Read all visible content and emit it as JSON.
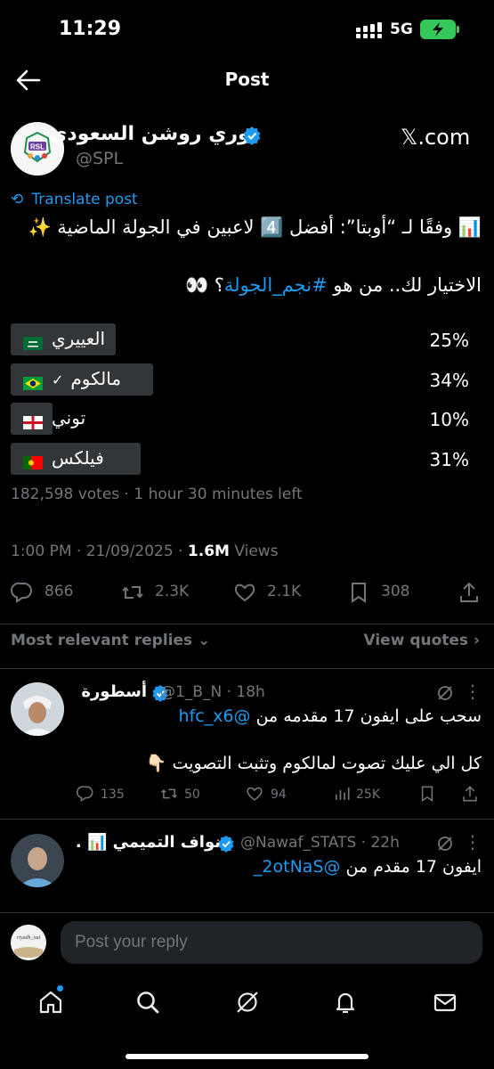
{
  "status_bar": {
    "time": "11:29",
    "network": "5G"
  },
  "header": {
    "title": "Post"
  },
  "post": {
    "author_name": "دوري روشن السعودي",
    "handle": "@SPL",
    "avatar_text": "RSL",
    "source_badge": "𝕏.com",
    "translate_label": "Translate post",
    "line1": "📊 وفقًا لـ “أوبتا”: أفضل 4️⃣ لاعبين في الجولة الماضية ✨",
    "line2_prefix": "الاختيار لك.. من هو ",
    "hashtag": "#نجم_الجولة",
    "line2_suffix": "؟ 👀",
    "poll": [
      {
        "label": "العييري",
        "percent": "25%",
        "value": 25,
        "flag": "saudi-flag"
      },
      {
        "label": "مالكوم",
        "percent": "34%",
        "value": 34,
        "flag": "brazil-flag",
        "chosen": true
      },
      {
        "label": "توني",
        "percent": "10%",
        "value": 10,
        "flag": "england-flag"
      },
      {
        "label": "فيلكس",
        "percent": "31%",
        "value": 31,
        "flag": "portugal-flag"
      }
    ],
    "votes": "182,598 votes · 1 hour 30 minutes left",
    "timestamp": "1:00 PM · 21/09/2025 · ",
    "views_count": "1.6M",
    "views_label": " Views",
    "actions": {
      "replies": "866",
      "reposts": "2.3K",
      "likes": "2.1K",
      "bookmarks": "308"
    }
  },
  "replies_header": {
    "sort": "Most relevant replies",
    "view_quotes": "View quotes"
  },
  "replies": [
    {
      "name": "أسطورة",
      "meta": "@1_B_N · 18h",
      "mention": "@hfc_x6",
      "text1": "سحب على ايفون 17 مقدمه من ",
      "text2": "كل الي عليك تصوت لمالكوم وتثبت التصويت 👇🏻",
      "replies": "135",
      "reposts": "50",
      "likes": "94",
      "views": "25K"
    },
    {
      "name": "نواف التميمي 📊 .",
      "meta": "@Nawaf_STATS · 22h",
      "mention": "@2otNaS_",
      "text1": "ايفون 17 مقدم من "
    }
  ],
  "composer": {
    "placeholder": "Post your reply",
    "avatar_text": "riyadh_out"
  },
  "colors": {
    "accent": "#1d9bf0",
    "background": "#000000",
    "muted": "#71767b",
    "poll_bar": "#333639",
    "battery": "#34c759"
  }
}
